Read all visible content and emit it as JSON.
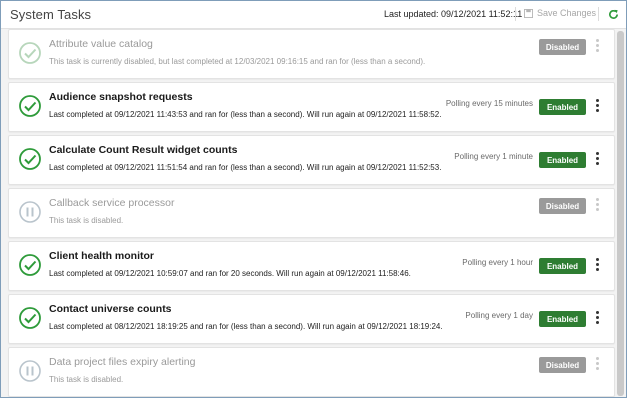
{
  "header": {
    "title": "System Tasks",
    "last_updated_label": "Last updated: 09/12/2021 11:52:11",
    "save_label": "Save Changes"
  },
  "colors": {
    "enabled": "#2e7d32",
    "disabled": "#9a9a9a",
    "ok_icon": "#2e9b3a"
  },
  "tasks": [
    {
      "name": "Attribute value catalog",
      "desc": "This task is currently disabled, but last completed at 12/03/2021 09:16:15 and ran for (less than a second).",
      "polling": "",
      "state": "Disabled",
      "icon": "check-circle-icon"
    },
    {
      "name": "Audience snapshot requests",
      "desc": "Last completed at 09/12/2021 11:43:53 and ran for (less than a second). Will run again at 09/12/2021 11:58:52.",
      "polling": "Polling every 15 minutes",
      "state": "Enabled",
      "icon": "check-circle-icon"
    },
    {
      "name": "Calculate Count Result widget counts",
      "desc": "Last completed at 09/12/2021 11:51:54 and ran for (less than a second). Will run again at 09/12/2021 11:52:53.",
      "polling": "Polling every 1 minute",
      "state": "Enabled",
      "icon": "check-circle-icon"
    },
    {
      "name": "Callback service processor",
      "desc": "This task is disabled.",
      "polling": "",
      "state": "Disabled",
      "icon": "pause-circle-icon"
    },
    {
      "name": "Client health monitor",
      "desc": "Last completed at 09/12/2021 10:59:07 and ran for 20 seconds. Will run again at 09/12/2021 11:58:46.",
      "polling": "Polling every 1 hour",
      "state": "Enabled",
      "icon": "check-circle-icon"
    },
    {
      "name": "Contact universe counts",
      "desc": "Last completed at 08/12/2021 18:19:25 and ran for (less than a second). Will run again at 09/12/2021 18:19:24.",
      "polling": "Polling every 1 day",
      "state": "Enabled",
      "icon": "check-circle-icon"
    },
    {
      "name": "Data project files expiry alerting",
      "desc": "This task is disabled.",
      "polling": "",
      "state": "Disabled",
      "icon": "pause-circle-icon"
    }
  ]
}
